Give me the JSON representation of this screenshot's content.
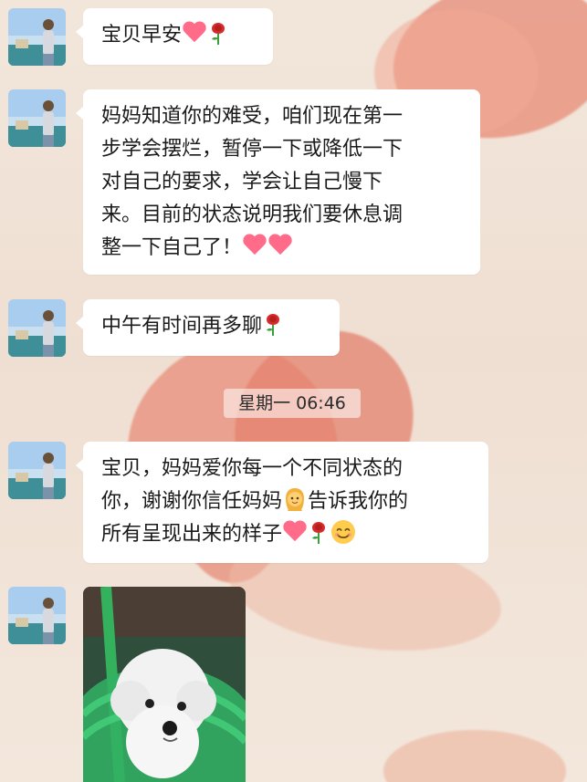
{
  "chat": {
    "messages": [
      {
        "type": "text",
        "lines": [
          "宝贝早安"
        ]
      },
      {
        "type": "text",
        "lines": [
          "妈妈知道你的难受，咱们现在第一",
          "步学会摆烂，暂停一下或降低一下",
          "对自己的要求，学会让自己慢下",
          "来。目前的状态说明我们要休息调",
          "整一下自己了！"
        ]
      },
      {
        "type": "text",
        "lines": [
          "中午有时间再多聊"
        ]
      },
      {
        "type": "time",
        "text": "星期一 06:46"
      },
      {
        "type": "text",
        "lines": [
          "宝贝，妈妈爱你每一个不同状态的",
          "你，谢谢你信任妈妈",
          "告诉我你的",
          "所有呈现出来的样子"
        ]
      },
      {
        "type": "image",
        "alt": ""
      }
    ]
  },
  "icons": {
    "heart": "heart-emoji",
    "rose": "rose-emoji",
    "smile": "smiling-face-emoji",
    "woman": "woman-emoji"
  },
  "colors": {
    "bubble": "#ffffff",
    "text": "#1a1a1a",
    "background": "#efe2d6",
    "heart": "#ff6b88",
    "rose": "#d62b2b",
    "stem": "#3c9f3c"
  }
}
